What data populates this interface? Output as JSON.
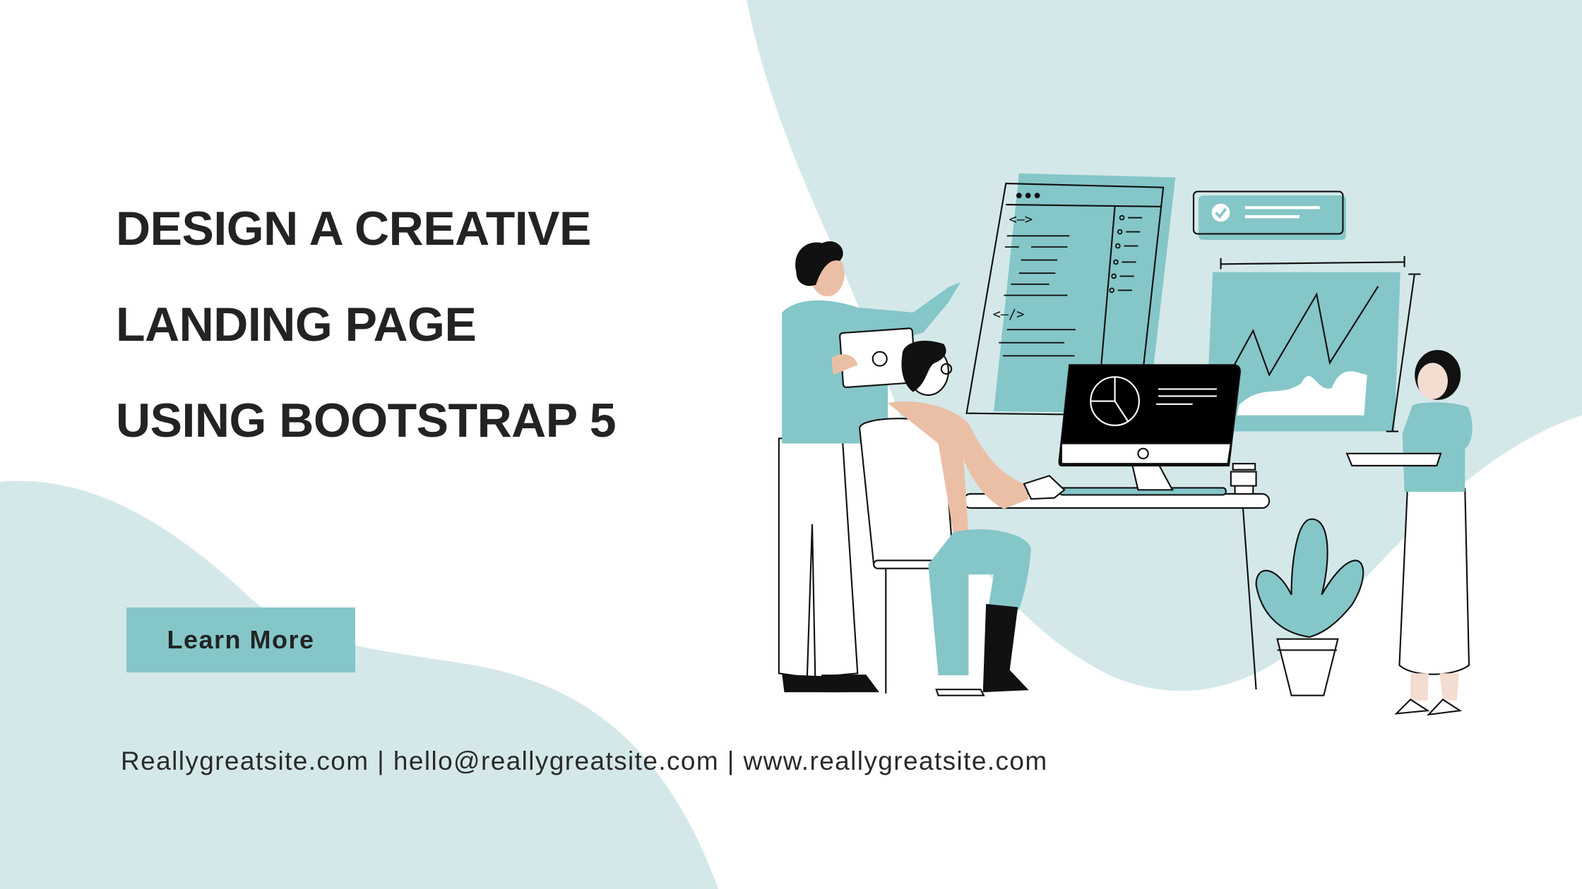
{
  "hero": {
    "title_lines": [
      "DESIGN A CREATIVE",
      "LANDING PAGE",
      "USING BOOTSTRAP 5"
    ],
    "cta_label": "Learn More"
  },
  "footer": {
    "contact": "Reallygreatsite.com | hello@reallygreatsite.com | www.reallygreatsite.com"
  },
  "colors": {
    "accent": "#85c6c8",
    "background_blob": "#d4e8e9",
    "text": "#232323",
    "skin": "#ebbfa5"
  },
  "illustration": {
    "code_panel_tags": [
      "<—>",
      "<—/>"
    ]
  }
}
